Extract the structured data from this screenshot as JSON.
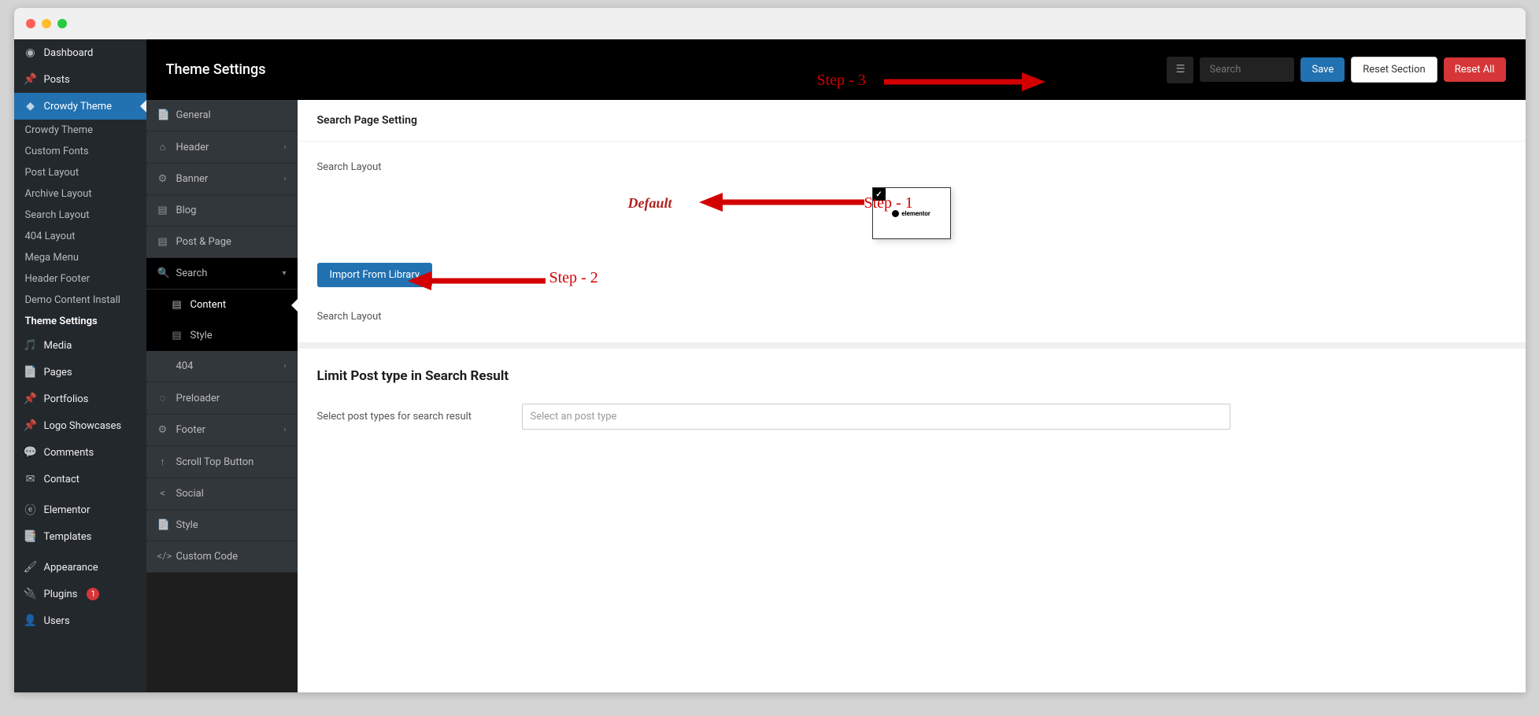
{
  "page_title": "Theme Settings",
  "header": {
    "search_placeholder": "Search",
    "save": "Save",
    "reset_section": "Reset Section",
    "reset_all": "Reset All"
  },
  "wp_menu": [
    {
      "icon": "dashboard",
      "label": "Dashboard"
    },
    {
      "icon": "pin",
      "label": "Posts"
    },
    {
      "icon": "theme",
      "label": "Crowdy Theme",
      "active": true,
      "submenu": [
        "Crowdy Theme",
        "Custom Fonts",
        "Post Layout",
        "Archive Layout",
        "Search Layout",
        "404 Layout",
        "Mega Menu",
        "Header Footer",
        "Demo Content Install",
        "Theme Settings"
      ],
      "current_sub": 9
    },
    {
      "icon": "media",
      "label": "Media"
    },
    {
      "icon": "pages",
      "label": "Pages"
    },
    {
      "icon": "pin",
      "label": "Portfolios"
    },
    {
      "icon": "pin",
      "label": "Logo Showcases"
    },
    {
      "icon": "comments",
      "label": "Comments"
    },
    {
      "icon": "mail",
      "label": "Contact"
    },
    {
      "sep": true
    },
    {
      "icon": "elementor",
      "label": "Elementor"
    },
    {
      "icon": "templates",
      "label": "Templates"
    },
    {
      "sep": true
    },
    {
      "icon": "brush",
      "label": "Appearance"
    },
    {
      "icon": "plug",
      "label": "Plugins",
      "badge": "1"
    },
    {
      "icon": "user",
      "label": "Users"
    }
  ],
  "settings_menu": [
    {
      "icon": "doc",
      "label": "General"
    },
    {
      "icon": "home",
      "label": "Header",
      "chev": true
    },
    {
      "icon": "gear",
      "label": "Banner",
      "chev": true
    },
    {
      "icon": "book",
      "label": "Blog"
    },
    {
      "icon": "book",
      "label": "Post & Page"
    },
    {
      "icon": "search",
      "label": "Search",
      "expanded": true,
      "chev": "down",
      "subs": [
        {
          "icon": "book",
          "label": "Content",
          "active": true
        },
        {
          "icon": "book",
          "label": "Style"
        }
      ]
    },
    {
      "icon": "",
      "label": "404",
      "chev": true
    },
    {
      "icon": "spin",
      "label": "Preloader"
    },
    {
      "icon": "gear",
      "label": "Footer",
      "chev": true
    },
    {
      "icon": "up",
      "label": "Scroll Top Button"
    },
    {
      "icon": "share",
      "label": "Social"
    },
    {
      "icon": "doc",
      "label": "Style"
    },
    {
      "icon": "code",
      "label": "Custom Code"
    }
  ],
  "panel": {
    "header": "Search Page Setting",
    "search_layout_label": "Search Layout",
    "layout_option": "elementor",
    "import_button": "Import From Library",
    "search_layout_label2": "Search Layout",
    "limit_section_title": "Limit Post type in Search Result",
    "select_label": "Select post types for search result",
    "select_placeholder": "Select an post type"
  },
  "annotations": {
    "default": "Default",
    "step1": "Step - 1",
    "step2": "Step - 2",
    "step3": "Step - 3"
  },
  "icons": {
    "dashboard": "◉",
    "pin": "📌",
    "theme": "◆",
    "media": "🎵",
    "pages": "📄",
    "comments": "💬",
    "mail": "✉",
    "elementor": "ⓔ",
    "templates": "📑",
    "brush": "🖌",
    "plug": "🔌",
    "user": "👤",
    "doc": "📄",
    "home": "⌂",
    "gear": "⚙",
    "book": "▤",
    "search": "🔍",
    "spin": "◌",
    "up": "↑",
    "share": "<",
    "code": "</>"
  }
}
